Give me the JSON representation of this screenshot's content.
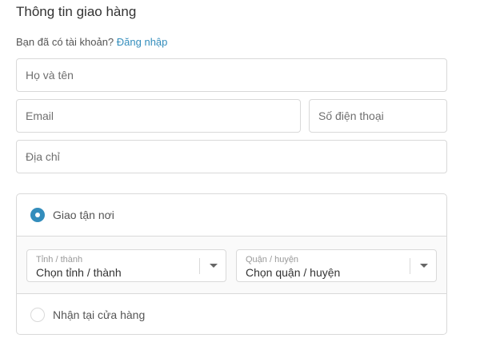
{
  "header": {
    "title": "Thông tin giao hàng",
    "login_prompt": "Bạn đã có tài khoản?",
    "login_link": "Đăng nhập"
  },
  "form": {
    "name_placeholder": "Họ và tên",
    "email_placeholder": "Email",
    "phone_placeholder": "Số điện thoại",
    "address_placeholder": "Địa chỉ"
  },
  "shipping": {
    "option_home": {
      "label": "Giao tận nơi",
      "selected": true
    },
    "option_store": {
      "label": "Nhận tại cửa hàng",
      "selected": false
    },
    "province": {
      "label": "Tỉnh / thành",
      "value": "Chọn tỉnh / thành"
    },
    "district": {
      "label": "Quận / huyện",
      "value": "Chọn quận / huyện"
    }
  },
  "colors": {
    "accent": "#338dbc",
    "border": "#d9d9d9",
    "text": "#333333"
  }
}
